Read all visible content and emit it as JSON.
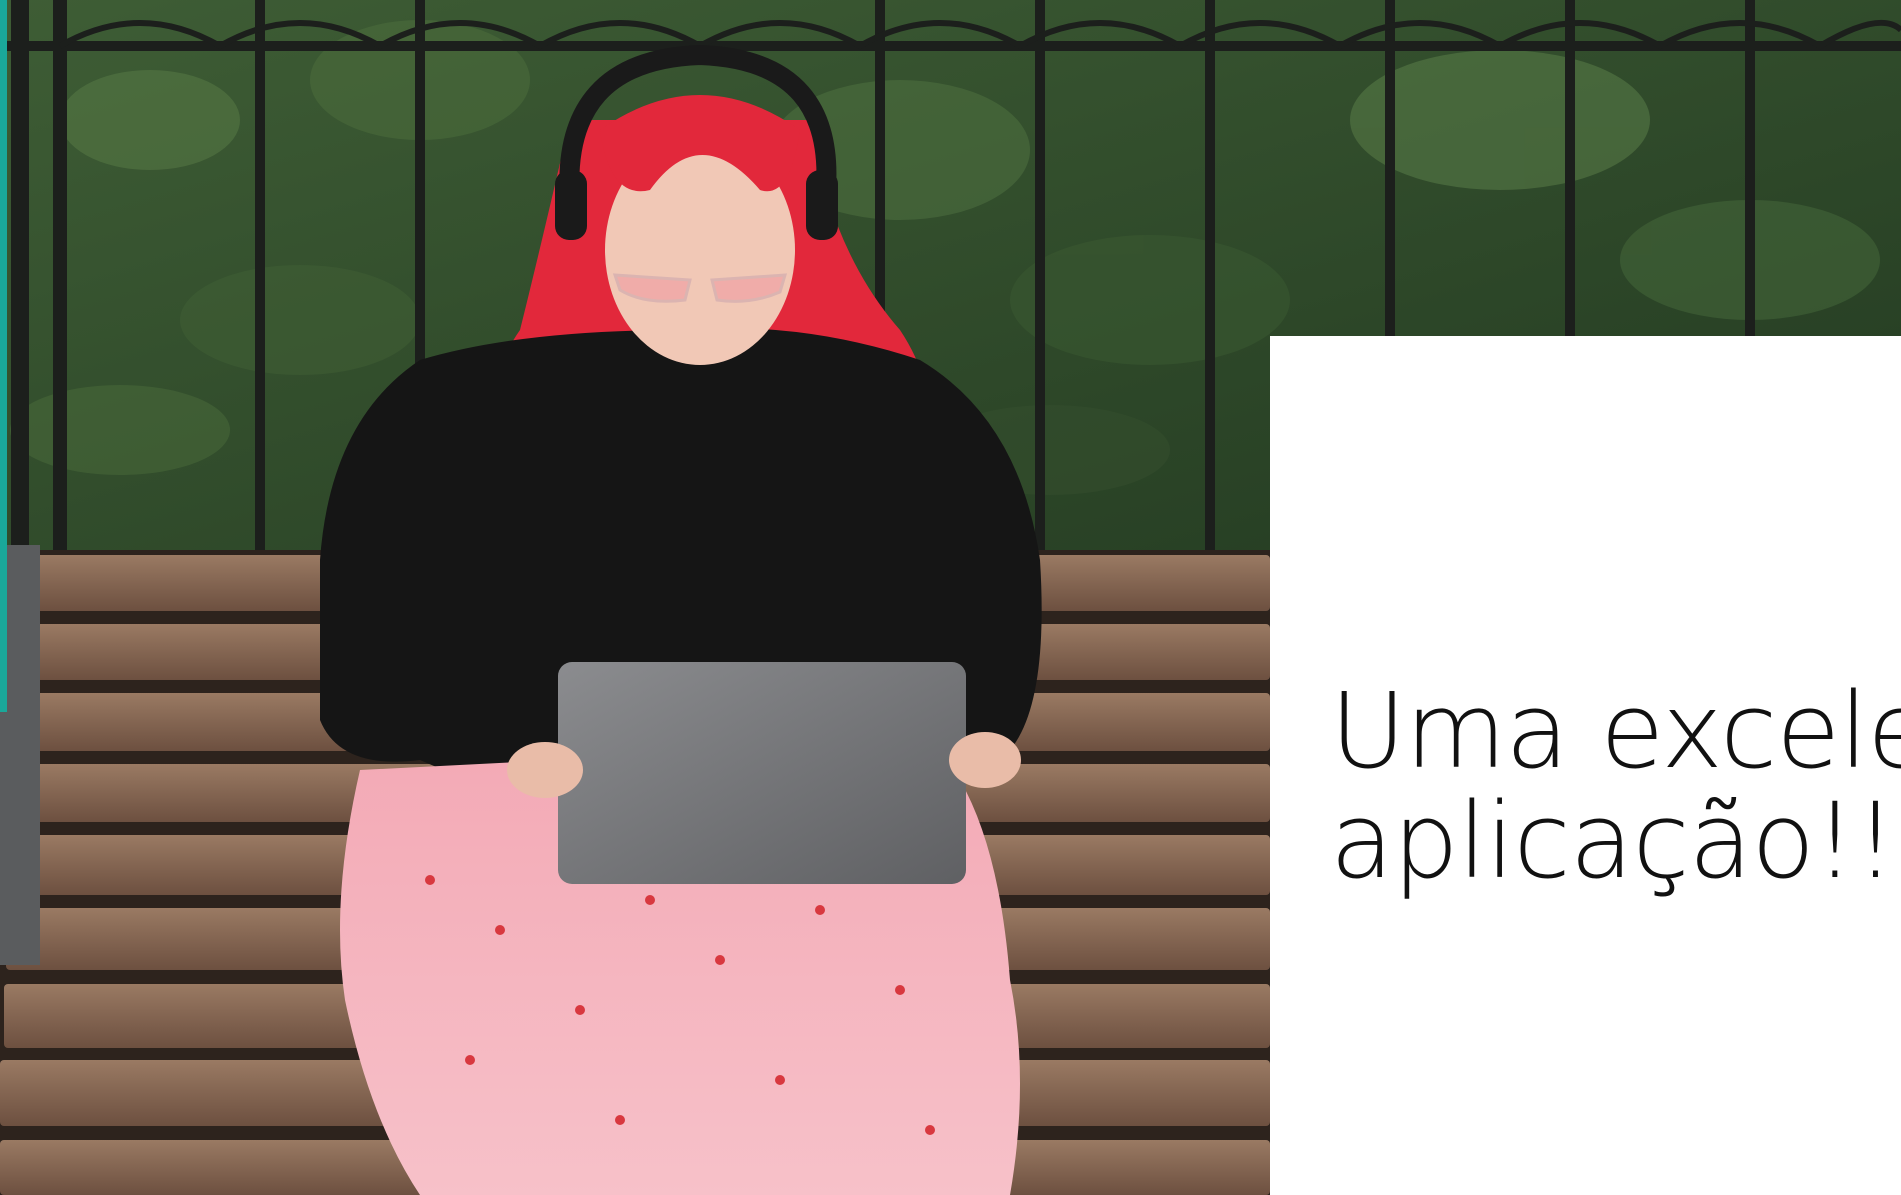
{
  "caption": {
    "line1": "Uma excele",
    "line2": "aplicação!!!"
  },
  "colors": {
    "accent_teal": "#1aa89a",
    "foliage": "#2f4a2a",
    "fence": "#1c1f1c",
    "bench_wood": "#8a6a55",
    "hoodie": "#151515",
    "skirt_pink": "#f1a3b0",
    "hair_red": "#e2283b",
    "laptop": "#77787a"
  }
}
